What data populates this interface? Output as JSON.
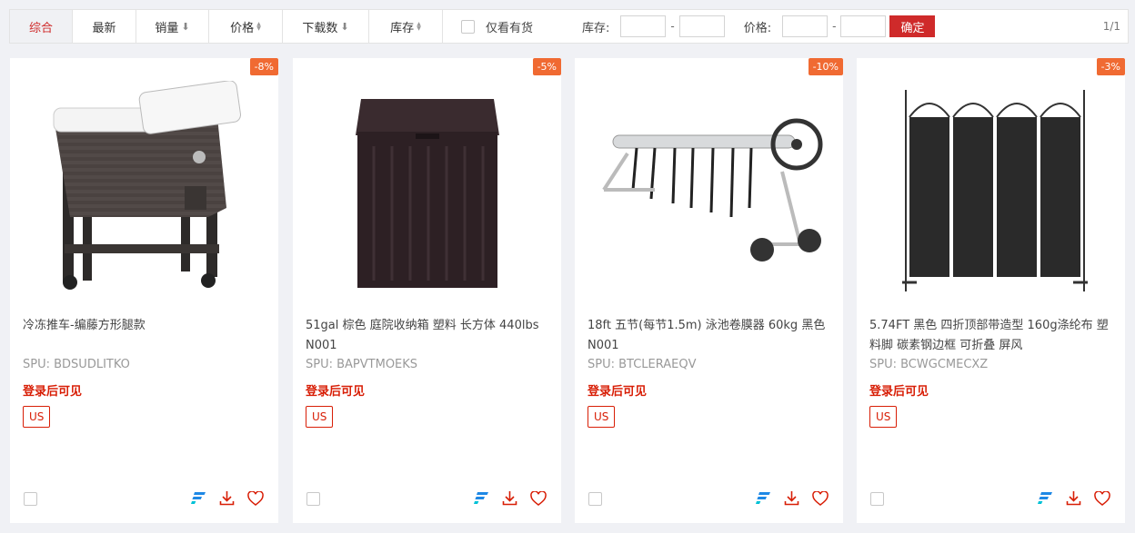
{
  "sort_tabs": [
    {
      "label": "综合",
      "indicator": ""
    },
    {
      "label": "最新",
      "indicator": ""
    },
    {
      "label": "销量",
      "indicator": "down"
    },
    {
      "label": "价格",
      "indicator": "updown"
    },
    {
      "label": "下载数",
      "indicator": "down"
    },
    {
      "label": "库存",
      "indicator": "updown"
    }
  ],
  "filter": {
    "in_stock_label": "仅看有货",
    "stock_label": "库存:",
    "price_label": "价格:",
    "dash": "-",
    "confirm_label": "确定",
    "page_info": "1/1"
  },
  "products": [
    {
      "discount": "-8%",
      "title": "冷冻推车-编藤方形腿款",
      "spu": "SPU:  BDSUDLITKO",
      "login_text": "登录后可见",
      "region": "US",
      "image_icon": "cooler-cart-image"
    },
    {
      "discount": "-5%",
      "title": "51gal 棕色 庭院收纳箱 塑料 长方体 440lbs N001",
      "spu": "SPU:  BAPVTMOEKS",
      "login_text": "登录后可见",
      "region": "US",
      "image_icon": "storage-box-image"
    },
    {
      "discount": "-10%",
      "title": "18ft 五节(每节1.5m) 泳池卷膜器 60kg 黑色 N001",
      "spu": "SPU:  BTCLERAEQV",
      "login_text": "登录后可见",
      "region": "US",
      "image_icon": "pool-reel-image"
    },
    {
      "discount": "-3%",
      "title": "5.74FT 黑色 四折顶部带造型 160g涤纶布 塑料脚 碳素钢边框 可折叠 屏风",
      "spu": "SPU:  BCWGCMECXZ",
      "login_text": "登录后可见",
      "region": "US",
      "image_icon": "folding-screen-image"
    }
  ],
  "colors": {
    "accent": "#cf2a2a",
    "badge": "#f06a32",
    "flash_icon": "#1e88e5"
  }
}
